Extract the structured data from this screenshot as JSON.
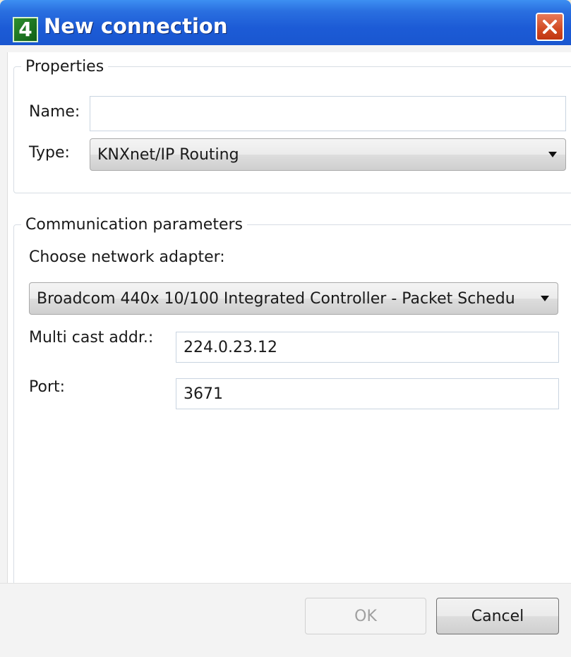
{
  "window": {
    "title": "New connection",
    "app_icon_text": "4",
    "close_icon": "close-icon",
    "accent_color": "#1c5bd6",
    "close_color": "#d14a22"
  },
  "properties": {
    "legend": "Properties",
    "name_label": "Name:",
    "name_value": "",
    "type_label": "Type:",
    "type_value": "KNXnet/IP Routing"
  },
  "communication": {
    "legend": "Communication parameters",
    "adapter_label": "Choose network adapter:",
    "adapter_value": "Broadcom 440x 10/100 Integrated Controller - Packet Schedu",
    "multicast_label": "Multi cast addr.:",
    "multicast_value": "224.0.23.12",
    "port_label": "Port:",
    "port_value": "3671"
  },
  "buttons": {
    "ok_label": "OK",
    "ok_enabled": false,
    "cancel_label": "Cancel"
  }
}
